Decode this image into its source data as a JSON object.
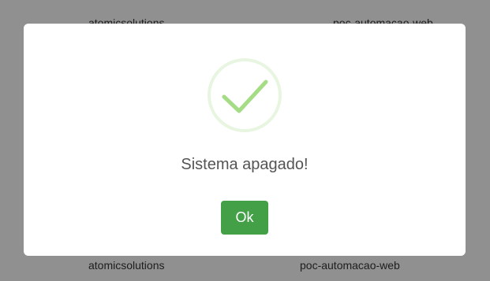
{
  "background": {
    "top_left_label": "atomicsolutions",
    "top_right_label": "poc-automacao-web",
    "bottom_left_label": "atomicsolutions",
    "bottom_right_label": "poc-automacao-web"
  },
  "dialog": {
    "icon": "success-check-icon",
    "title": "Sistema apagado!",
    "ok_label": "Ok"
  },
  "colors": {
    "accent": "#43a047",
    "check": "#a5dc86",
    "ring": "#e8f5e0"
  }
}
